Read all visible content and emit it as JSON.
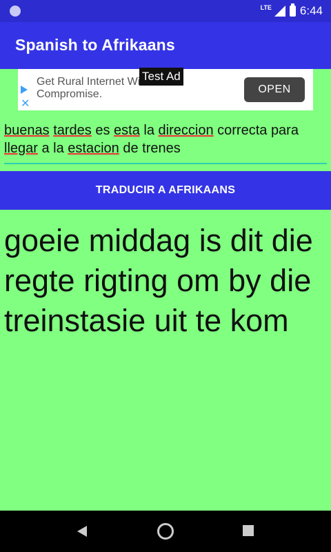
{
  "status_bar": {
    "network": "LTE",
    "time": "6:44"
  },
  "app_bar": {
    "title": "Spanish to Afrikaans"
  },
  "ad": {
    "tag": "Test Ad",
    "line1": "Get Rural Internet Without",
    "line2": "Compromise.",
    "open_label": "OPEN"
  },
  "input": {
    "words": [
      {
        "text": "buenas",
        "underlined": true
      },
      {
        "text": " "
      },
      {
        "text": "tardes",
        "underlined": true
      },
      {
        "text": " es "
      },
      {
        "text": "esta",
        "underlined": true
      },
      {
        "text": " la "
      },
      {
        "text": "direccion",
        "underlined": true
      },
      {
        "text": " correcta para "
      },
      {
        "text": "llegar",
        "underlined": true
      },
      {
        "text": " a la "
      },
      {
        "text": "estacion",
        "underlined": true
      },
      {
        "text": " de trenes"
      }
    ]
  },
  "translate_button": {
    "label": "TRADUCIR A AFRIKAANS"
  },
  "result": {
    "text": "goeie middag is dit die regte rigting om by die treinstasie uit te kom"
  },
  "colors": {
    "status_bar": "#2C2CCF",
    "app_bar": "#3434E6",
    "background": "#80FF80",
    "button": "#3434E6"
  }
}
